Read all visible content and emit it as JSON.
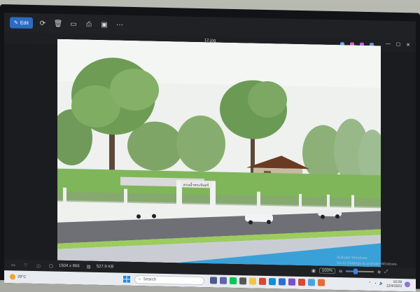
{
  "toolbar": {
    "edit_label": "Edit",
    "tools": [
      {
        "name": "rotate-icon"
      },
      {
        "name": "delete-icon"
      },
      {
        "name": "crop-icon"
      },
      {
        "name": "print-icon"
      },
      {
        "name": "slideshow-icon"
      },
      {
        "name": "more-icon"
      }
    ]
  },
  "title_bar": {
    "title": "12.jpg"
  },
  "sign": {
    "text": "สวนน้ำพระจันทร์"
  },
  "status": {
    "dimensions": "1504 x 866",
    "file_size": "527.9 KB",
    "zoom": "100%",
    "zoom_fraction": 0.35
  },
  "watermark": {
    "line1": "Activate Windows",
    "line2": "Go to Settings to activate Windows."
  },
  "taskbar": {
    "weather": "29°C",
    "search_placeholder": "Search",
    "time": "10:28",
    "date": "12/4/2023"
  },
  "colors": {
    "accent": "#2b6cc4",
    "taskbar": "#e8ebef"
  }
}
